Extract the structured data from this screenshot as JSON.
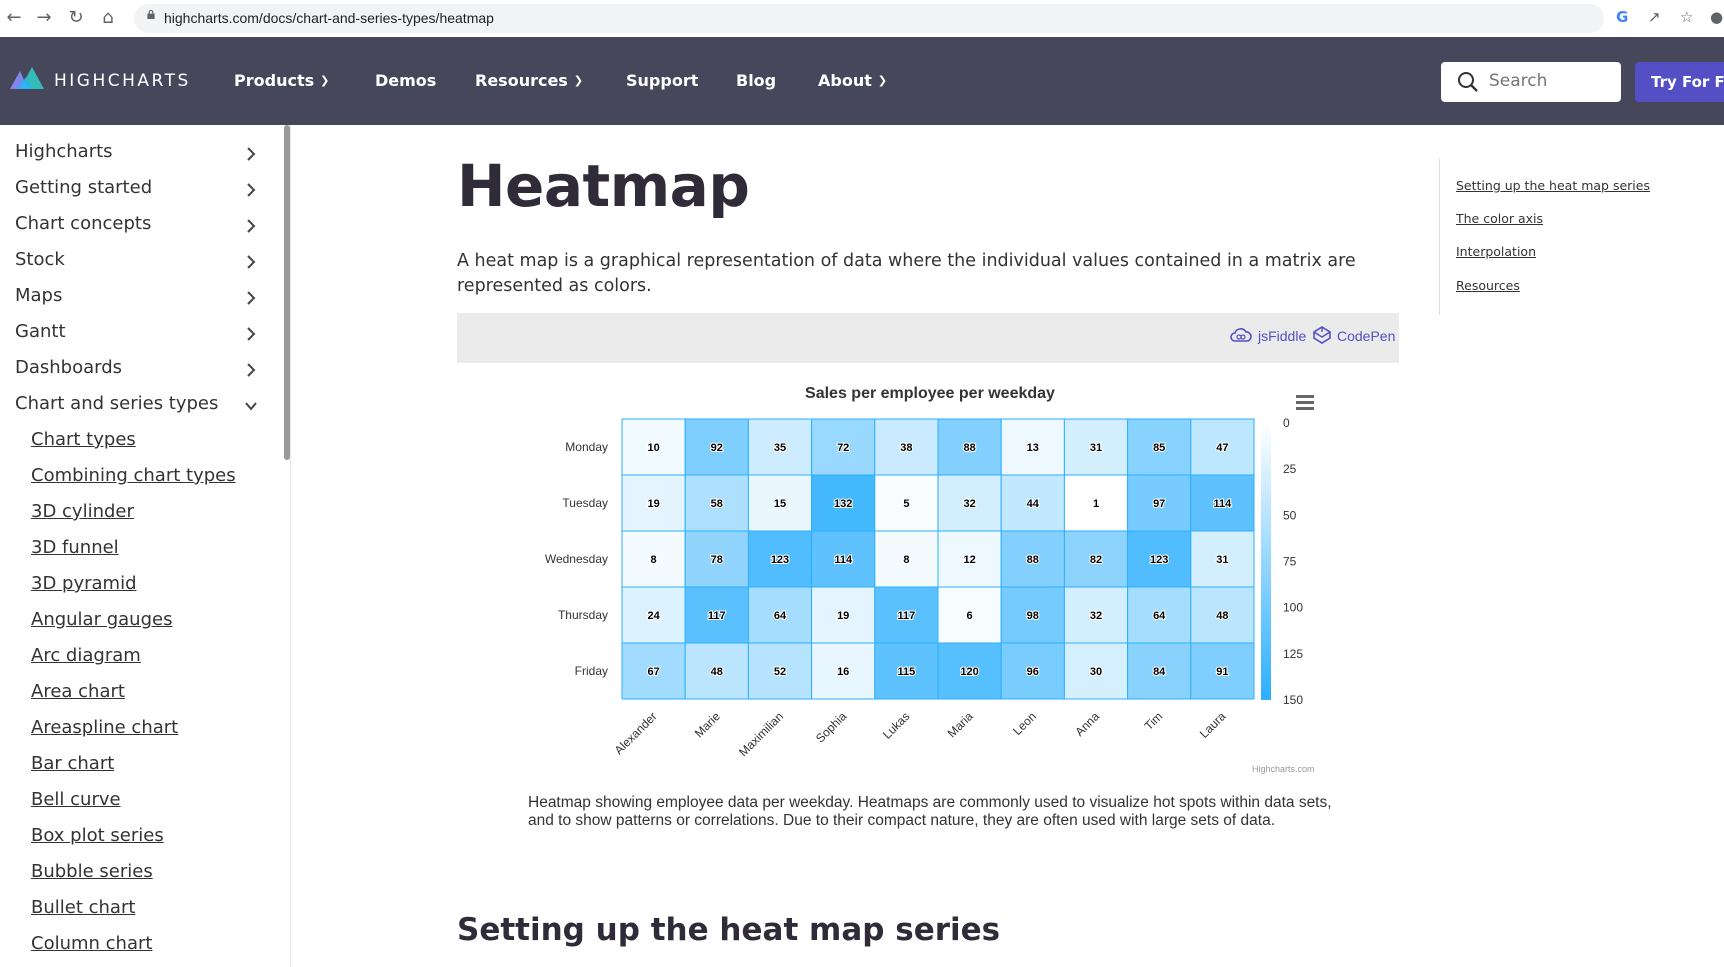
{
  "browser": {
    "url": "highcharts.com/docs/chart-and-series-types/heatmap"
  },
  "header": {
    "logo_text": "HIGHCHARTS",
    "menu": [
      {
        "label": "Products",
        "dropdown": true
      },
      {
        "label": "Demos",
        "dropdown": false
      },
      {
        "label": "Resources",
        "dropdown": true
      },
      {
        "label": "Support",
        "dropdown": false
      },
      {
        "label": "Blog",
        "dropdown": false
      },
      {
        "label": "About",
        "dropdown": true
      }
    ],
    "search_placeholder": "Search",
    "try_label": "Try For Fre"
  },
  "sidebar": {
    "items": [
      {
        "label": "Highcharts",
        "state": "collapsed"
      },
      {
        "label": "Getting started",
        "state": "collapsed"
      },
      {
        "label": "Chart concepts",
        "state": "collapsed"
      },
      {
        "label": "Stock",
        "state": "collapsed"
      },
      {
        "label": "Maps",
        "state": "collapsed"
      },
      {
        "label": "Gantt",
        "state": "collapsed"
      },
      {
        "label": "Dashboards",
        "state": "collapsed"
      },
      {
        "label": "Chart and series types",
        "state": "expanded"
      }
    ],
    "sub_items": [
      "Chart types",
      "Combining chart types",
      "3D cylinder",
      "3D funnel",
      "3D pyramid",
      "Angular gauges",
      "Arc diagram",
      "Area chart",
      "Areaspline chart",
      "Bar chart",
      "Bell curve",
      "Box plot series",
      "Bubble series",
      "Bullet chart",
      "Column chart"
    ]
  },
  "main": {
    "title": "Heatmap",
    "intro": "A heat map is a graphical representation of data where the individual values contained in a matrix are represented as colors.",
    "demo_links": [
      "jsFiddle",
      "CodePen"
    ],
    "caption": "Heatmap showing employee data per weekday. Heatmaps are commonly used to visualize hot spots within data sets, and to show patterns or correlations. Due to their compact nature, they are often used with large sets of data.",
    "section_heading": "Setting up the heat map series",
    "credits": "Highcharts.com"
  },
  "toc": [
    "Setting up the heat map series",
    "The color axis",
    "Interpolation",
    "Resources"
  ],
  "colors": {
    "header_bg": "#47475c",
    "accent": "#544fc5",
    "heat_min": "#ffffff",
    "heat_max": "#2caffe"
  },
  "chart_data": {
    "type": "heatmap",
    "title": "Sales per employee per weekday",
    "x_categories": [
      "Alexander",
      "Marie",
      "Maximilian",
      "Sophia",
      "Lukas",
      "Maria",
      "Leon",
      "Anna",
      "Tim",
      "Laura"
    ],
    "y_categories": [
      "Monday",
      "Tuesday",
      "Wednesday",
      "Thursday",
      "Friday"
    ],
    "values": [
      [
        10,
        92,
        35,
        72,
        38,
        88,
        13,
        31,
        85,
        47
      ],
      [
        19,
        58,
        15,
        132,
        5,
        32,
        44,
        1,
        97,
        114
      ],
      [
        8,
        78,
        123,
        114,
        8,
        12,
        88,
        82,
        123,
        31
      ],
      [
        24,
        117,
        64,
        19,
        117,
        6,
        98,
        32,
        64,
        48
      ],
      [
        67,
        48,
        52,
        16,
        115,
        120,
        96,
        30,
        84,
        91
      ]
    ],
    "color_axis": {
      "min": 0,
      "max": 150,
      "ticks": [
        0,
        25,
        50,
        75,
        100,
        125,
        150
      ]
    },
    "data_labels": true,
    "legend": "right"
  }
}
